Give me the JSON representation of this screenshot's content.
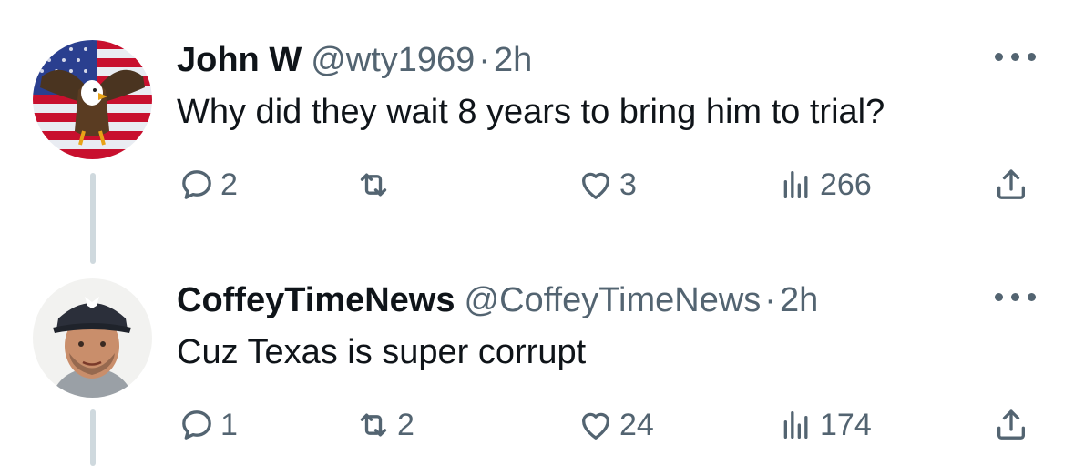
{
  "colors": {
    "text_primary": "#0f1419",
    "text_secondary": "#536471",
    "thread_line": "#cfd9de"
  },
  "tweets": [
    {
      "name": "John W",
      "handle": "@wty1969",
      "separator": "·",
      "time": "2h",
      "text": "Why did they wait 8 years to bring him to trial?",
      "avatar_icon": "eagle-flag-avatar",
      "replies": "2",
      "retweets": "",
      "likes": "3",
      "views": "266"
    },
    {
      "name": "CoffeyTimeNews",
      "handle": "@CoffeyTimeNews",
      "separator": "·",
      "time": "2h",
      "text": "Cuz Texas is super corrupt",
      "avatar_icon": "man-in-cap-avatar",
      "replies": "1",
      "retweets": "2",
      "likes": "24",
      "views": "174"
    }
  ]
}
